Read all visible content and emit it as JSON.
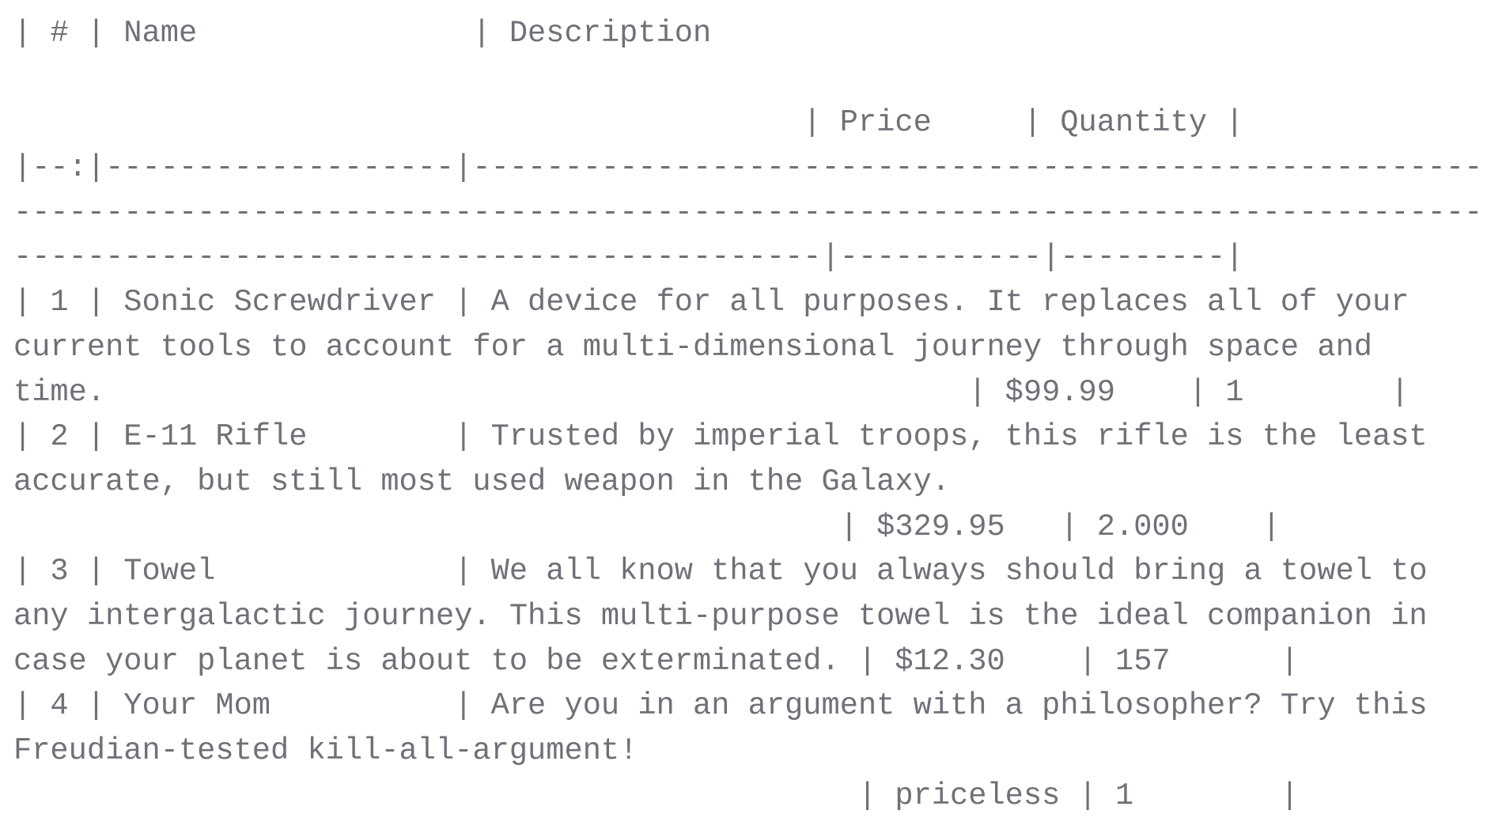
{
  "document": {
    "lines": [
      "| # | Name               | Description",
      "",
      "                                           | Price     | Quantity |",
      "|--:|-------------------|-------------------------------------------------------",
      "--------------------------------------------------------------------------------",
      "--------------------------------------------|-----------|---------|",
      "| 1 | Sonic Screwdriver | A device for all purposes. It replaces all of your",
      "current tools to account for a multi-dimensional journey through space and",
      "time.                                               | $99.99    | 1        |",
      "| 2 | E-11 Rifle        | Trusted by imperial troops, this rifle is the least",
      "accurate, but still most used weapon in the Galaxy.",
      "                                             | $329.95   | 2.000    |",
      "| 3 | Towel             | We all know that you always should bring a towel to",
      "any intergalactic journey. This multi-purpose towel is the ideal companion in",
      "case your planet is about to be exterminated. | $12.30    | 157      |",
      "| 4 | Your Mom          | Are you in an argument with a philosopher? Try this",
      "Freudian-tested kill-all-argument!",
      "                                              | priceless | 1        |"
    ]
  }
}
